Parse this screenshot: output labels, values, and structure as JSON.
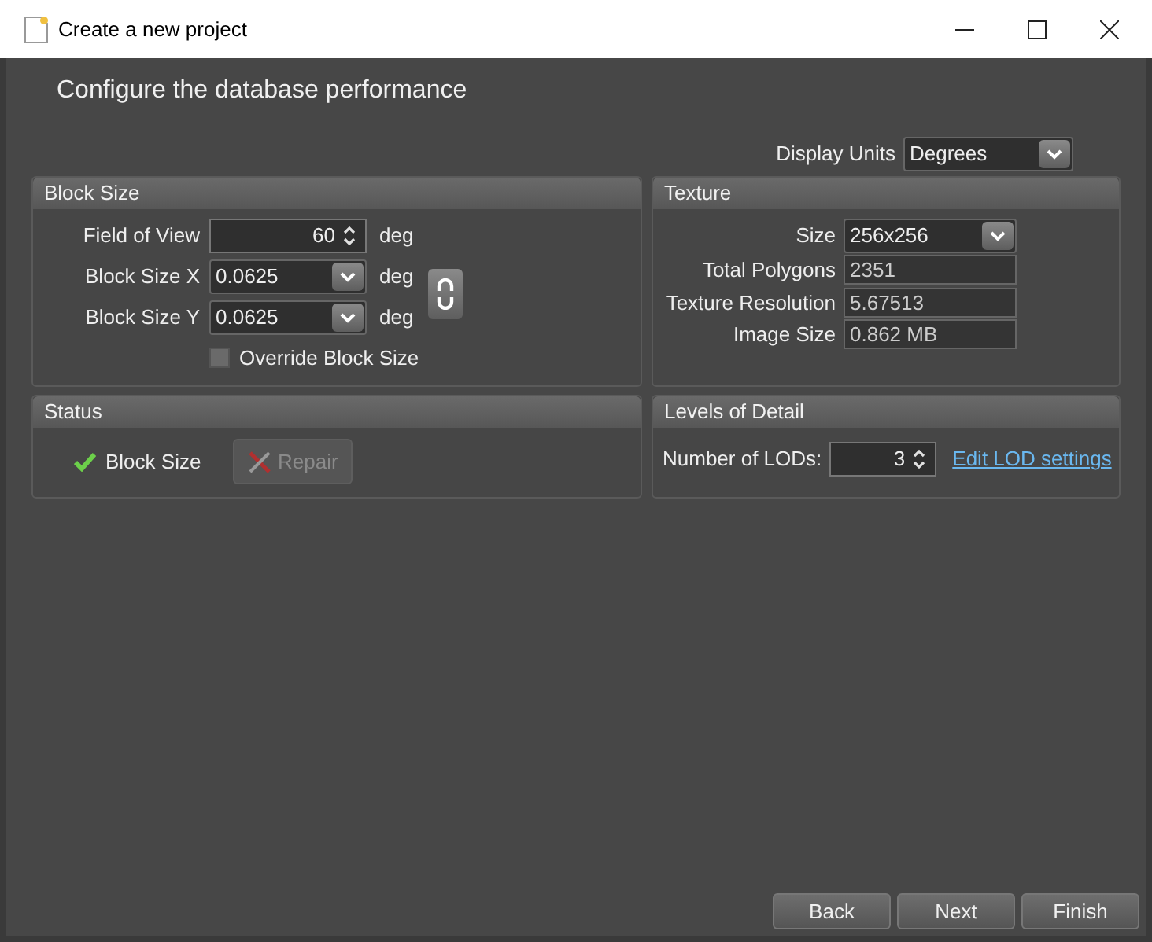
{
  "window": {
    "title": "Create a new project"
  },
  "heading": "Configure the database performance",
  "display_units": {
    "label": "Display Units",
    "value": "Degrees"
  },
  "block_size": {
    "title": "Block Size",
    "fields": [
      {
        "kind": "spin",
        "label": "Field of View",
        "value": "60",
        "unit": "deg"
      },
      {
        "kind": "combo",
        "label": "Block Size X",
        "value": "0.0625",
        "unit": "deg"
      },
      {
        "kind": "combo",
        "label": "Block Size Y",
        "value": "0.0625",
        "unit": "deg"
      }
    ],
    "linked": true,
    "override": {
      "label": "Override Block Size",
      "checked": false
    }
  },
  "texture": {
    "title": "Texture",
    "fields": [
      {
        "kind": "combo",
        "label": "Size",
        "value": "256x256"
      },
      {
        "kind": "readonly",
        "label": "Total Polygons",
        "value": "2351"
      },
      {
        "kind": "readonly",
        "label": "Texture Resolution",
        "value": "5.67513"
      },
      {
        "kind": "readonly",
        "label": "Image Size",
        "value": "0.862 MB"
      }
    ]
  },
  "status": {
    "title": "Status",
    "item": {
      "label": "Block Size",
      "ok": true
    },
    "repair": {
      "label": "Repair",
      "disabled": true
    }
  },
  "lod": {
    "title": "Levels of Detail",
    "label": "Number of LODs:",
    "value": "3",
    "link": "Edit LOD settings"
  },
  "buttons": [
    {
      "label": "Back"
    },
    {
      "label": "Next"
    },
    {
      "label": "Finish"
    }
  ]
}
